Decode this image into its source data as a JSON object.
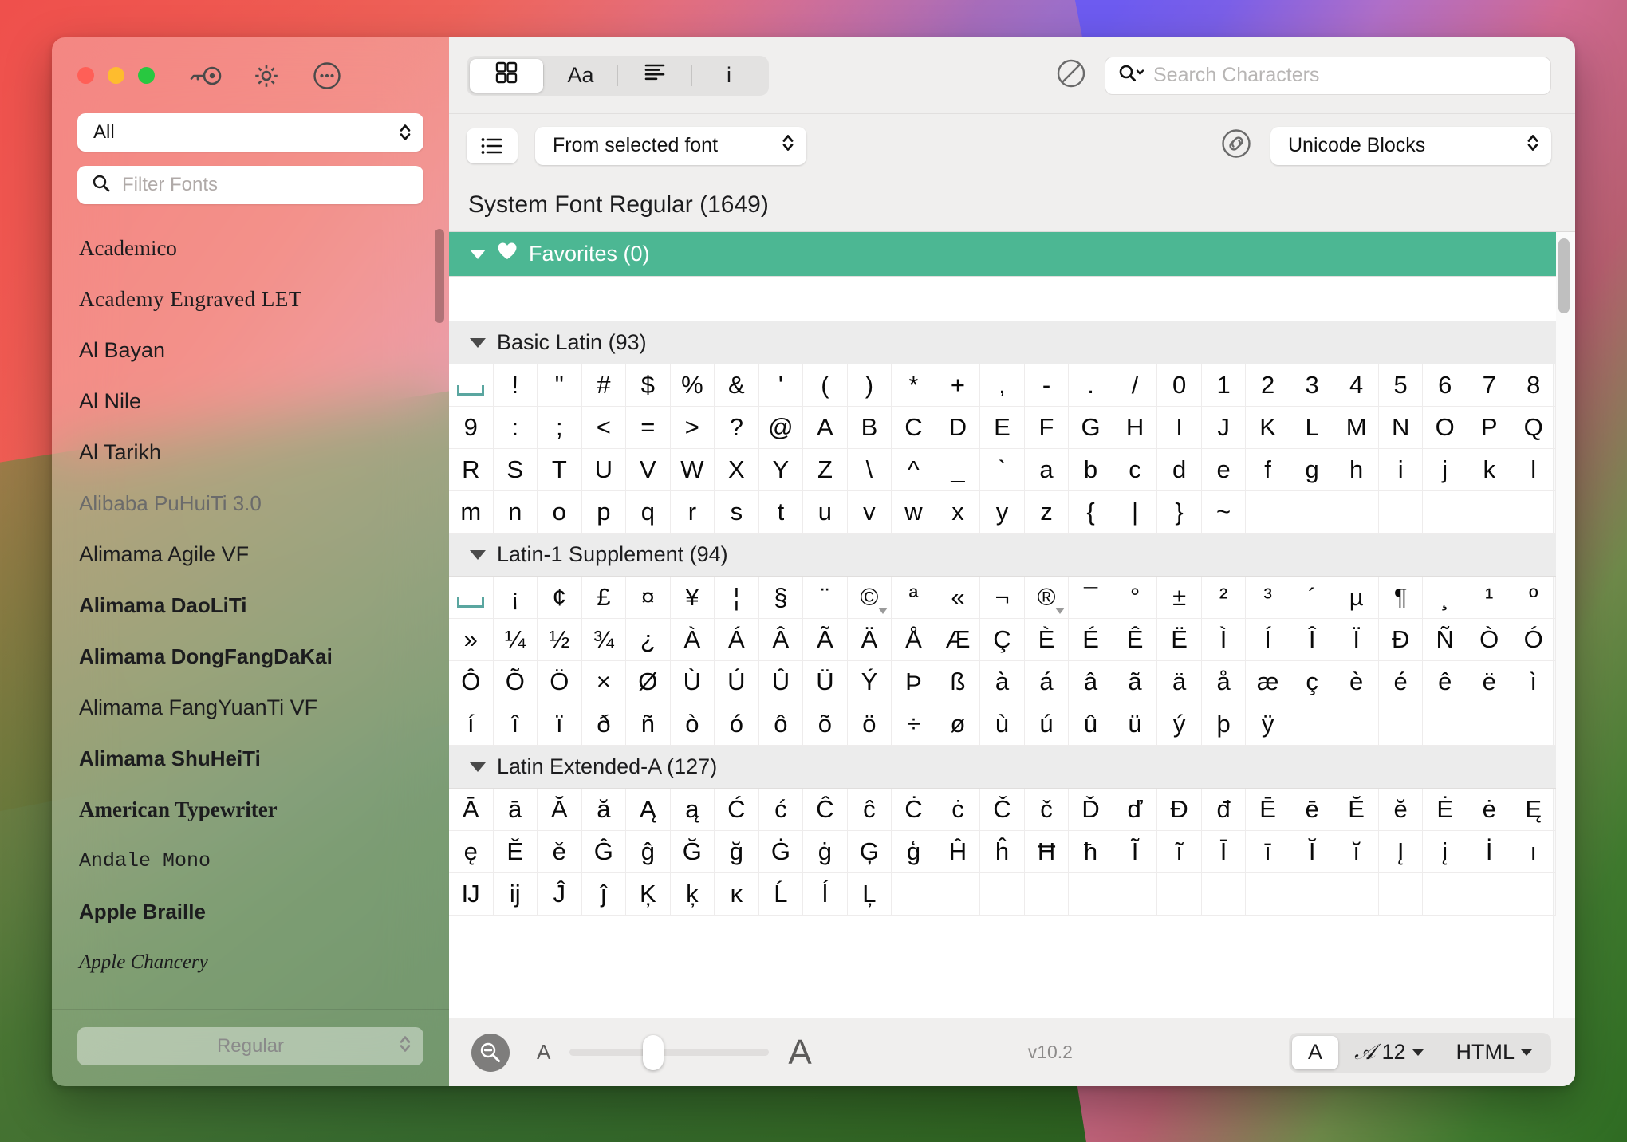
{
  "window": {
    "traffic_lights": [
      "close",
      "minimize",
      "zoom"
    ],
    "sidebar_tools": [
      "key-icon",
      "gear-icon",
      "more-icon"
    ]
  },
  "sidebar": {
    "collection_popup": {
      "value": "All"
    },
    "filter": {
      "placeholder": "Filter Fonts",
      "value": ""
    },
    "fonts": [
      {
        "name": "Academico",
        "style": "f-academico"
      },
      {
        "name": "Academy Engraved LET",
        "style": "f-academy"
      },
      {
        "name": "Al Bayan",
        "style": "f-plain"
      },
      {
        "name": "Al Nile",
        "style": "f-plain"
      },
      {
        "name": "Al Tarikh",
        "style": "f-plain"
      },
      {
        "name": "Alibaba PuHuiTi 3.0",
        "style": "f-light"
      },
      {
        "name": "Alimama Agile VF",
        "style": "f-plain"
      },
      {
        "name": "Alimama DaoLiTi",
        "style": "f-semibold"
      },
      {
        "name": "Alimama DongFangDaKai",
        "style": "f-bold"
      },
      {
        "name": "Alimama FangYuanTi VF",
        "style": "f-plain"
      },
      {
        "name": "Alimama ShuHeiTi",
        "style": "f-bold"
      },
      {
        "name": "American Typewriter",
        "style": "f-serif"
      },
      {
        "name": "Andale Mono",
        "style": "f-mono"
      },
      {
        "name": "Apple Braille",
        "style": "f-semibold"
      },
      {
        "name": "Apple Chancery",
        "style": "f-chancery"
      }
    ],
    "style_popup": {
      "value": "Regular"
    }
  },
  "toolbar": {
    "view_segments": [
      {
        "name": "grid-view",
        "label": "",
        "icon": "grid-icon",
        "active": true
      },
      {
        "name": "font-view",
        "label": "Aa",
        "icon": "",
        "active": false
      },
      {
        "name": "list-view",
        "label": "",
        "icon": "lines-icon",
        "active": false
      },
      {
        "name": "info-view",
        "label": "i",
        "icon": "",
        "active": false
      }
    ],
    "clear_icon": "no-entry-icon",
    "search": {
      "placeholder": "Search Characters",
      "value": ""
    },
    "list_button_icon": "list-icon",
    "source_popup": {
      "value": "From selected font"
    },
    "link_icon": "link-icon",
    "grouping_popup": {
      "value": "Unicode Blocks"
    }
  },
  "content": {
    "font_title": "System Font Regular (1649)",
    "sections": [
      {
        "name": "favorites",
        "title": "Favorites (0)",
        "icon": "heart-icon",
        "color": "#4cb793",
        "expanded": true,
        "chars": []
      },
      {
        "name": "basic-latin",
        "title": "Basic Latin (93)",
        "expanded": true,
        "chars": [
          " ",
          "!",
          "\"",
          "#",
          "$",
          "%",
          "&",
          "'",
          "(",
          ")",
          "*",
          "+",
          ",",
          "-",
          ".",
          "/",
          "0",
          "1",
          "2",
          "3",
          "4",
          "5",
          "6",
          "7",
          "8",
          "9",
          ":",
          ";",
          "<",
          "=",
          ">",
          "?",
          "@",
          "A",
          "B",
          "C",
          "D",
          "E",
          "F",
          "G",
          "H",
          "I",
          "J",
          "K",
          "L",
          "M",
          "N",
          "O",
          "P",
          "Q",
          "R",
          "S",
          "T",
          "U",
          "V",
          "W",
          "X",
          "Y",
          "Z",
          "\\",
          "^",
          "_",
          "`",
          "a",
          "b",
          "c",
          "d",
          "e",
          "f",
          "g",
          "h",
          "i",
          "j",
          "k",
          "l",
          "m",
          "n",
          "o",
          "p",
          "q",
          "r",
          "s",
          "t",
          "u",
          "v",
          "w",
          "x",
          "y",
          "z",
          "{",
          "|",
          "}",
          "~"
        ]
      },
      {
        "name": "latin-1-supplement",
        "title": "Latin-1 Supplement (94)",
        "expanded": true,
        "chars": [
          " ",
          "¡",
          "¢",
          "£",
          "¤",
          "¥",
          "¦",
          "§",
          "¨",
          "©",
          "ª",
          "«",
          "¬",
          "®",
          "¯",
          "°",
          "±",
          "²",
          "³",
          "´",
          "µ",
          "¶",
          "¸",
          "¹",
          "º",
          "»",
          "¼",
          "½",
          "¾",
          "¿",
          "À",
          "Á",
          "Â",
          "Ã",
          "Ä",
          "Å",
          "Æ",
          "Ç",
          "È",
          "É",
          "Ê",
          "Ë",
          "Ì",
          "Í",
          "Î",
          "Ï",
          "Ð",
          "Ñ",
          "Ò",
          "Ó",
          "Ô",
          "Õ",
          "Ö",
          "×",
          "Ø",
          "Ù",
          "Ú",
          "Û",
          "Ü",
          "Ý",
          "Þ",
          "ß",
          "à",
          "á",
          "â",
          "ã",
          "ä",
          "å",
          "æ",
          "ç",
          "è",
          "é",
          "ê",
          "ë",
          "ì",
          "í",
          "î",
          "ï",
          "ð",
          "ñ",
          "ò",
          "ó",
          "ô",
          "õ",
          "ö",
          "÷",
          "ø",
          "ù",
          "ú",
          "û",
          "ü",
          "ý",
          "þ",
          "ÿ"
        ],
        "variant_indices": [
          9,
          13
        ]
      },
      {
        "name": "latin-extended-a",
        "title": "Latin Extended-A (127)",
        "expanded": true,
        "chars": [
          "Ā",
          "ā",
          "Ă",
          "ă",
          "Ą",
          "ą",
          "Ć",
          "ć",
          "Ĉ",
          "ĉ",
          "Ċ",
          "ċ",
          "Č",
          "č",
          "Ď",
          "ď",
          "Đ",
          "đ",
          "Ē",
          "ē",
          "Ĕ",
          "ĕ",
          "Ė",
          "ė",
          "Ę",
          "ę",
          "Ě",
          "ě",
          "Ĝ",
          "ĝ",
          "Ğ",
          "ğ",
          "Ġ",
          "ġ",
          "Ģ",
          "ģ",
          "Ĥ",
          "ĥ",
          "Ħ",
          "ħ",
          "Ĩ",
          "ĩ",
          "Ī",
          "ī",
          "Ĭ",
          "ĭ",
          "Į",
          "į",
          "İ",
          "ı",
          "Ĳ",
          "ĳ",
          "Ĵ",
          "ĵ",
          "Ķ",
          "ķ",
          "ĸ",
          "Ĺ",
          "ĺ",
          "Ļ"
        ]
      }
    ]
  },
  "bottom_bar": {
    "zoom_icon": "zoom-out-icon",
    "size_slider": {
      "min_label": "A",
      "max_label": "A",
      "value_percent": 42
    },
    "version": "v10.2",
    "segments": [
      {
        "name": "char-preview",
        "label": "A",
        "active": true
      },
      {
        "name": "font-size",
        "label": "12",
        "icon": "script-a-icon",
        "active": false,
        "has_caret": true
      },
      {
        "name": "copy-format",
        "label": "HTML",
        "active": false,
        "has_caret": true
      }
    ]
  }
}
